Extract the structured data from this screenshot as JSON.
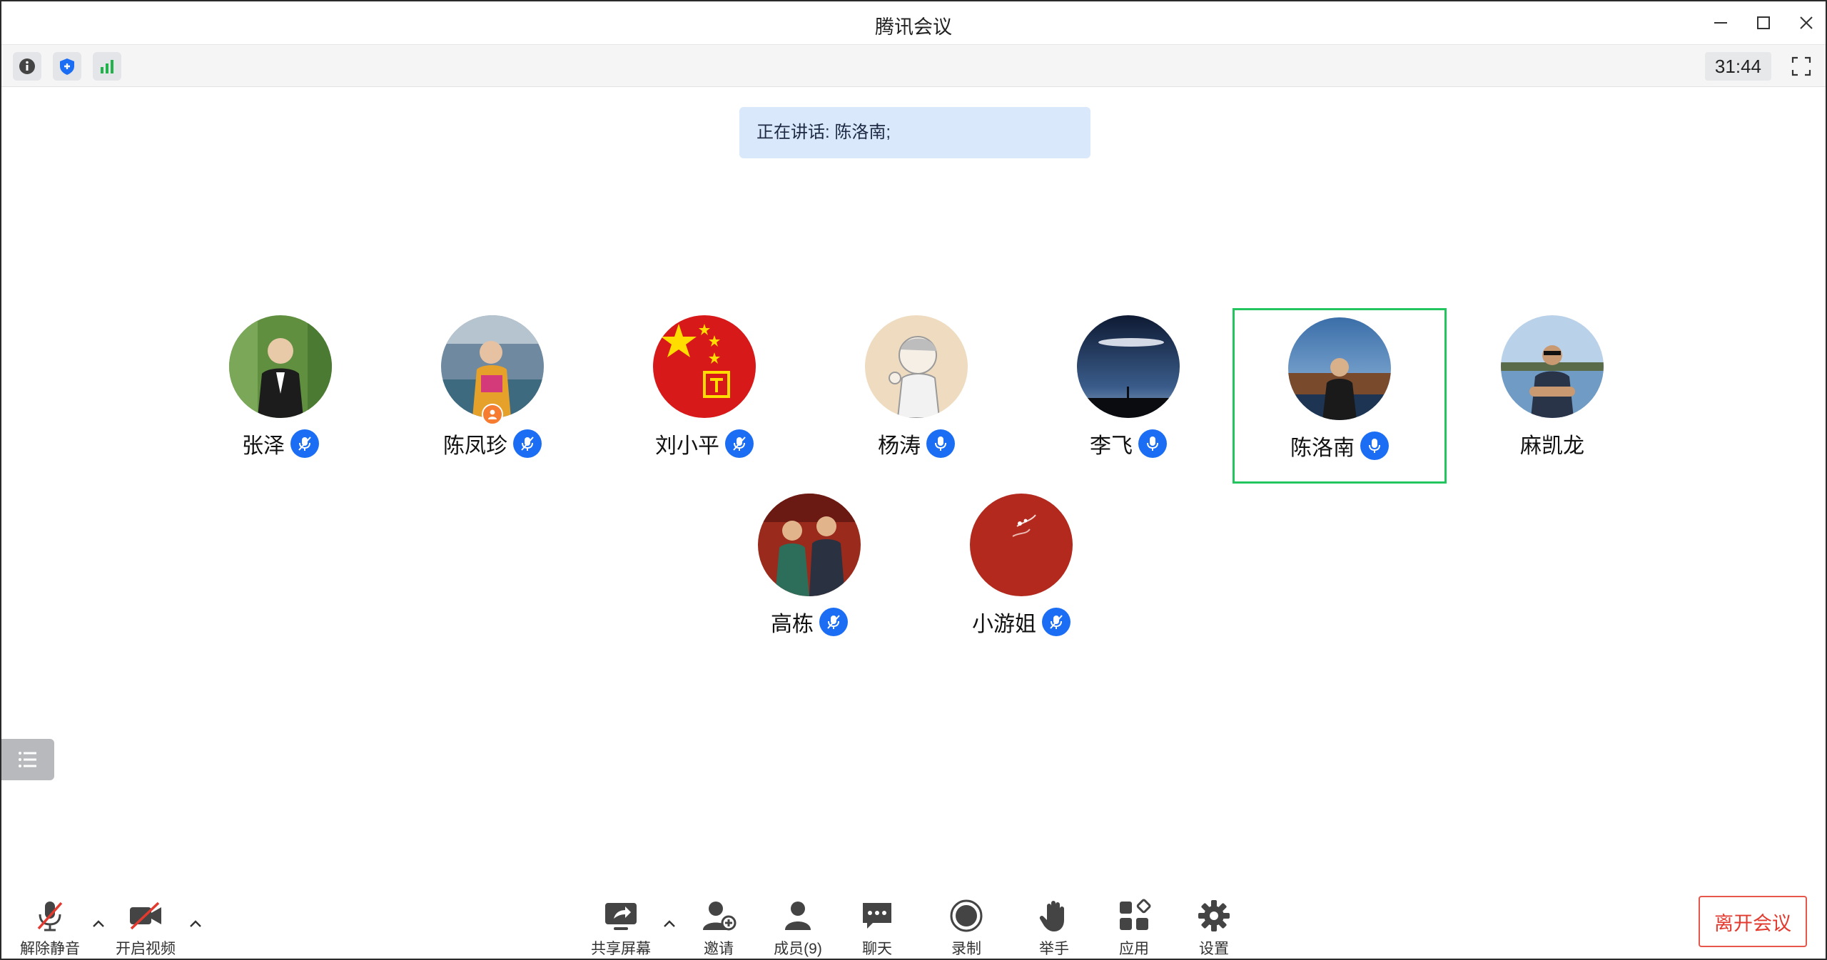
{
  "window": {
    "title": "腾讯会议"
  },
  "infobar": {
    "icons": [
      "info-icon",
      "shield-icon",
      "signal-icon"
    ],
    "timer": "31:44"
  },
  "speaking": {
    "text": "正在讲话: 陈洛南;"
  },
  "participants": [
    {
      "name": "张泽",
      "mic": "muted"
    },
    {
      "name": "陈凤珍",
      "mic": "muted",
      "host": true
    },
    {
      "name": "刘小平",
      "mic": "muted"
    },
    {
      "name": "杨涛",
      "mic": "on"
    },
    {
      "name": "李飞",
      "mic": "on"
    },
    {
      "name": "陈洛南",
      "mic": "on",
      "speaking": true
    },
    {
      "name": "麻凯龙",
      "mic": "none"
    },
    {
      "name": "高栋",
      "mic": "muted"
    },
    {
      "name": "小游姐",
      "mic": "muted"
    }
  ],
  "toolbar": {
    "unmute": "解除静音",
    "video": "开启视频",
    "share": "共享屏幕",
    "invite": "邀请",
    "members": "成员(9)",
    "chat": "聊天",
    "record": "录制",
    "raise_hand": "举手",
    "apps": "应用",
    "settings": "设置",
    "leave": "离开会议"
  },
  "colors": {
    "accent": "#1b6ef3",
    "active_border": "#22c55e",
    "leave": "#e33a2f",
    "host": "#f57c30"
  }
}
